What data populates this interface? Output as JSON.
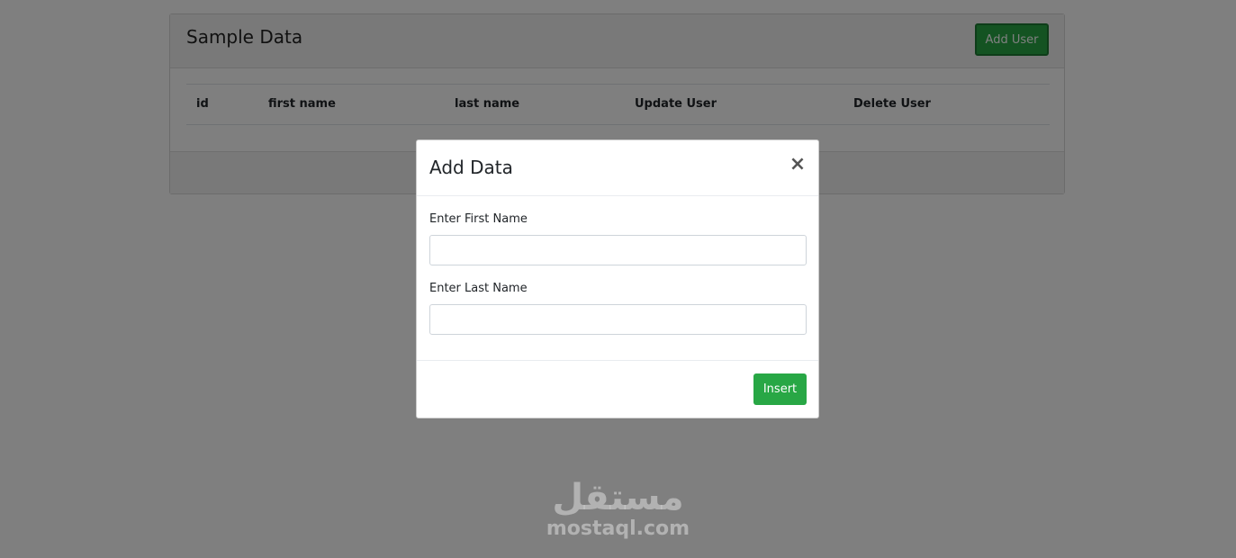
{
  "panel": {
    "title": "Sample Data",
    "add_user_label": "Add User",
    "table": {
      "headers": [
        "id",
        "first name",
        "last name",
        "Update User",
        "Delete User"
      ]
    }
  },
  "modal": {
    "title": "Add Data",
    "close_symbol": "×",
    "first_name_label": "Enter First Name",
    "first_name_value": "",
    "last_name_label": "Enter Last Name",
    "last_name_value": "",
    "insert_label": "Insert"
  },
  "watermark": {
    "arabic": "مستقل",
    "latin": "mostaql.com"
  },
  "colors": {
    "accent_green": "#28a745",
    "backdrop": "rgba(0,0,0,0.5)"
  }
}
